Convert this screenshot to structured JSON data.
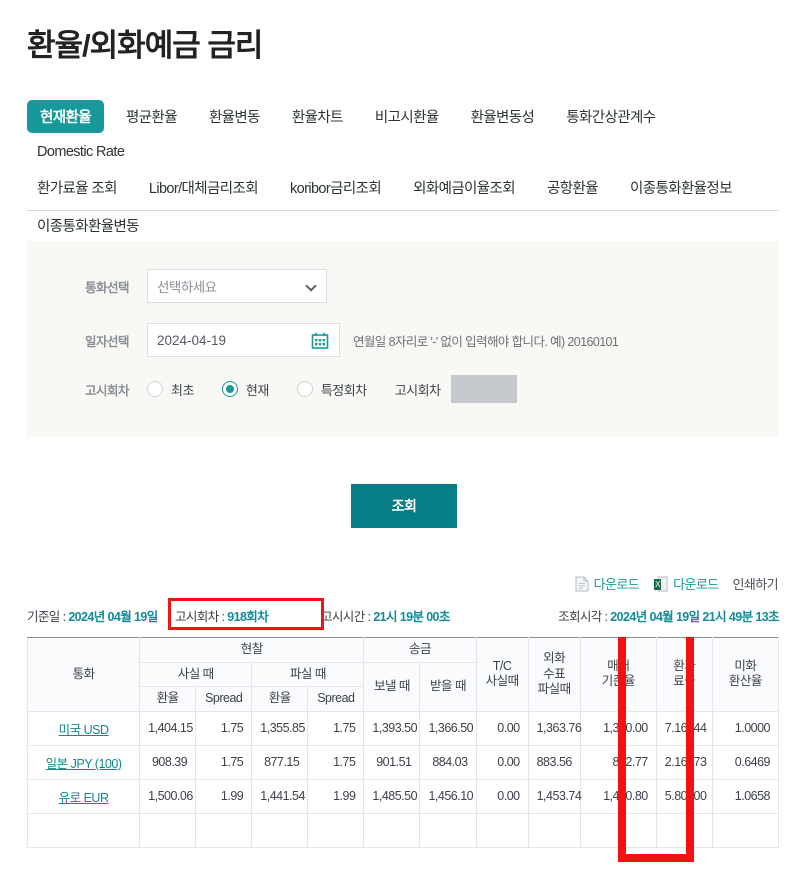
{
  "header": {
    "title": "환율/외화예금 금리"
  },
  "tabs": [
    {
      "label": "현재환율",
      "active": true
    },
    {
      "label": "평균환율",
      "active": false
    },
    {
      "label": "환율변동",
      "active": false
    },
    {
      "label": "환율차트",
      "active": false
    },
    {
      "label": "비고시환율",
      "active": false
    },
    {
      "label": "환율변동성",
      "active": false
    },
    {
      "label": "통화간상관계수",
      "active": false
    },
    {
      "label": "Domestic Rate",
      "active": false
    },
    {
      "label": "환가료율 조회",
      "active": false
    },
    {
      "label": "Libor/대체금리조회",
      "active": false
    },
    {
      "label": "koribor금리조회",
      "active": false
    },
    {
      "label": "외화예금이율조회",
      "active": false
    },
    {
      "label": "공항환율",
      "active": false
    },
    {
      "label": "이종통화환율정보",
      "active": false
    },
    {
      "label": "이종통화환율변동",
      "active": false
    }
  ],
  "form": {
    "currency_label": "통화선택",
    "currency_value": "선택하세요",
    "date_label": "일자선택",
    "date_value": "2024-04-19",
    "date_hint": "연월일 8자리로 '-' 없이 입력해야 합니다. 예) 20160101",
    "round_label": "고시회차",
    "radios": [
      {
        "label": "최초",
        "selected": false
      },
      {
        "label": "현재",
        "selected": true
      },
      {
        "label": "특정회차",
        "selected": false
      }
    ],
    "round_input_label": "고시회차",
    "round_input_value": ""
  },
  "actions": {
    "search_button": "조회",
    "download_doc": "다운로드",
    "download_excel": "다운로드",
    "print": "인쇄하기"
  },
  "info": {
    "base_date_label": "기준일 :",
    "base_date_value": "2024년 04월 19일",
    "round_label": "고시회차 :",
    "round_value": "918회차",
    "notice_time_label": "고시시간 :",
    "notice_time_value": "21시 19분 00초",
    "query_time_label": "조회시각 :",
    "query_time_value": "2024년 04월 19일  21시 49분 13초"
  },
  "table": {
    "headers": {
      "currency": "통화",
      "cash_group": "현찰",
      "cash_buy": "사실 때",
      "cash_sell": "파실 때",
      "rate": "환율",
      "spread": "Spread",
      "remit_group": "송금",
      "remit_send": "보낼 때",
      "remit_receive": "받을 때",
      "tc_buy": "T/C\n사실때",
      "check_sell": "외화\n수표\n파실때",
      "base_rate": "매매\n기준율",
      "exchange_fee": "환가\n료율",
      "usd_conv": "미화\n환산율"
    },
    "rows": [
      {
        "currency": "미국 USD",
        "cash_buy_rate": "1,404.15",
        "cash_buy_spread": "1.75",
        "cash_sell_rate": "1,355.85",
        "cash_sell_spread": "1.75",
        "remit_send": "1,393.50",
        "remit_receive": "1,366.50",
        "tc_buy": "0.00",
        "check_sell": "1,363.76",
        "base_rate": "1,380.00",
        "exchange_fee": "7.16544",
        "usd_conv": "1.0000"
      },
      {
        "currency": "일본 JPY (100)",
        "cash_buy_rate": "908.39",
        "cash_buy_spread": "1.75",
        "cash_sell_rate": "877.15",
        "cash_sell_spread": "1.75",
        "remit_send": "901.51",
        "remit_receive": "884.03",
        "tc_buy": "0.00",
        "check_sell": "883.56",
        "base_rate": "892.77",
        "exchange_fee": "2.16773",
        "usd_conv": "0.6469"
      },
      {
        "currency": "유로 EUR",
        "cash_buy_rate": "1,500.06",
        "cash_buy_spread": "1.99",
        "cash_sell_rate": "1,441.54",
        "cash_sell_spread": "1.99",
        "remit_send": "1,485.50",
        "remit_receive": "1,456.10",
        "tc_buy": "0.00",
        "check_sell": "1,453.74",
        "base_rate": "1,470.80",
        "exchange_fee": "5.80300",
        "usd_conv": "1.0658"
      }
    ]
  },
  "colors": {
    "accent_teal": "#17999b",
    "button_teal": "#077d85",
    "highlight_red": "#f31212",
    "link_teal": "#17868f",
    "panel_bg": "#f8f9f5"
  }
}
